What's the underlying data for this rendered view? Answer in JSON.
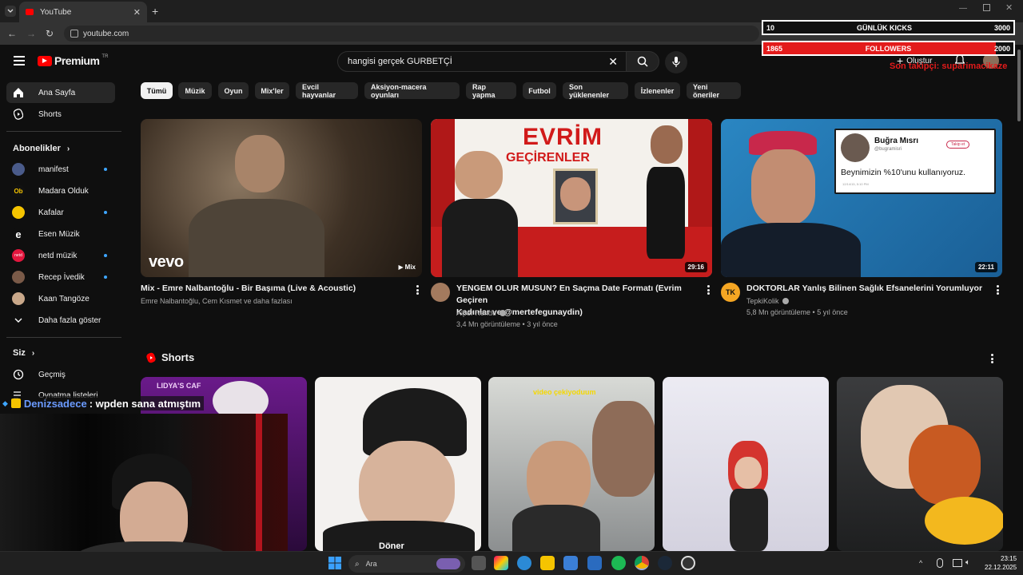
{
  "browser": {
    "tab_title": "YouTube",
    "url": "youtube.com"
  },
  "header": {
    "logo": "Premium",
    "logo_badge": "TR",
    "search_value": "hangisi gerçek GURBETÇİ",
    "create_label": "Oluştur"
  },
  "sidebar": {
    "items": [
      {
        "label": "Ana Sayfa",
        "icon": "home-icon"
      },
      {
        "label": "Shorts",
        "icon": "shorts-icon"
      }
    ],
    "subs_title": "Abonelikler",
    "subs": [
      {
        "label": "manifest",
        "dot": true
      },
      {
        "label": "Madara Olduk",
        "dot": false
      },
      {
        "label": "Kafalar",
        "dot": true
      },
      {
        "label": "Esen Müzik",
        "dot": false
      },
      {
        "label": "netd müzik",
        "dot": true
      },
      {
        "label": "Recep İvedik",
        "dot": true
      },
      {
        "label": "Kaan Tangöze",
        "dot": false
      }
    ],
    "show_more": "Daha fazla göster",
    "you_title": "Siz",
    "history": "Geçmiş",
    "playlists": "Oynatma listeleri"
  },
  "chips": [
    "Tümü",
    "Müzik",
    "Oyun",
    "Mix'ler",
    "Evcil hayvanlar",
    "Aksiyon-macera oyunları",
    "Rap yapma",
    "Futbol",
    "Son yüklenenler",
    "İzlenenler",
    "Yeni öneriler"
  ],
  "videos": [
    {
      "title": "Mix - Emre Nalbantoğlu - Bir Başıma (Live & Acoustic)",
      "meta1": "Emre Nalbantoğlu, Cem Kısmet ve daha fazlası",
      "badge": "Mix",
      "brand": "vevo"
    },
    {
      "title_line1": "YENGEM OLUR MUSUN? En Saçma Date Formatı (Evrim Geçiren",
      "title_line2": "Kadınlar ve @mertefegunaydin)",
      "channel": "Alper Rende",
      "stats": "3,4 Mn görüntüleme • 3 yıl önce",
      "duration": "29:16",
      "thumb_text1": "EVRİM",
      "thumb_text2": "GEÇİRENLER"
    },
    {
      "title": "DOKTORLAR Yanlış Bilinen Sağlık Efsanelerini Yorumluyor",
      "channel": "TepkiKolik",
      "stats": "5,8 Mn görüntüleme • 5 yıl önce",
      "duration": "22:11",
      "tweet_name": "Buğra Mısrı",
      "tweet_handle": "@bugramisri",
      "tweet_follow": "Takip et",
      "tweet_text": "Beynimizin %10'unu kullanıyoruz.",
      "tweet_time": "12/14/15, 5:10 PM",
      "channel_avatar_text": "TK"
    }
  ],
  "shorts": {
    "title": "Shorts",
    "items": [
      {
        "caption": "LIDYA'S CAF"
      },
      {
        "caption": "Döner"
      },
      {
        "caption": "video çekiyoduum"
      },
      {
        "caption": ""
      },
      {
        "caption": ""
      }
    ]
  },
  "overlay": {
    "chat_user": "Denizsadece",
    "chat_message": ": wpden sana atmıştım",
    "kicks_current": "10",
    "kicks_label": "GÜNLÜK KICKS",
    "kicks_goal": "3000",
    "followers_current": "1865",
    "followers_label": "FOLLOWERS",
    "followers_goal": "2000",
    "last_follower": "Son takipçi: suparimacikaze",
    "followers_fill": 0.93
  },
  "taskbar": {
    "search_placeholder": "Ara",
    "time": "23:15",
    "date": "22.12.2025"
  },
  "colors": {
    "accent_red": "#ff0000",
    "link_blue": "#3ea6ff",
    "bg": "#0f0f0f"
  }
}
